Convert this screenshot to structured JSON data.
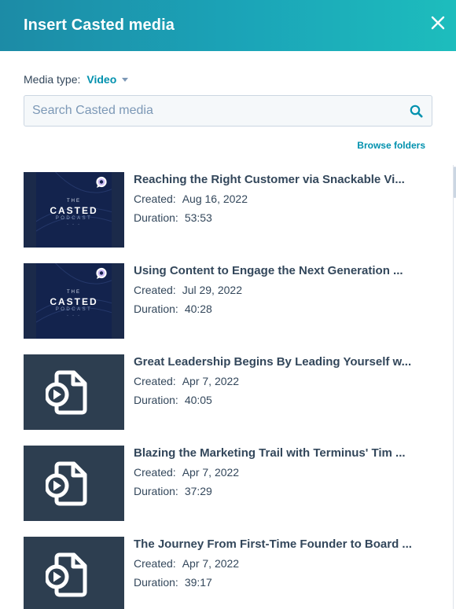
{
  "dialog": {
    "title": "Insert Casted media"
  },
  "media_type": {
    "label": "Media type:",
    "value": "Video"
  },
  "search": {
    "placeholder": "Search Casted media",
    "value": ""
  },
  "browse_folders": "Browse folders",
  "labels": {
    "created": "Created:",
    "duration": "Duration:"
  },
  "podcast_thumb": {
    "line1": "THE",
    "line2": "CASTED",
    "line3": "PODCAST",
    "line4": "◦ ◦ ◦"
  },
  "colors": {
    "accent": "#0091ae",
    "header_start": "#1c8ba6",
    "header_end": "#1dbdbd",
    "thumb_bg": "#2d3e50"
  },
  "items": [
    {
      "title": "Reaching the Right Customer via Snackable Vi...",
      "created": "Aug 16, 2022",
      "duration": "53:53",
      "thumb": "podcast-art"
    },
    {
      "title": "Using Content to Engage the Next Generation ...",
      "created": "Jul 29, 2022",
      "duration": "40:28",
      "thumb": "podcast-art"
    },
    {
      "title": "Great Leadership Begins By Leading Yourself w...",
      "created": "Apr 7, 2022",
      "duration": "40:05",
      "thumb": "video-file-icon"
    },
    {
      "title": "Blazing the Marketing Trail with Terminus' Tim ...",
      "created": "Apr 7, 2022",
      "duration": "37:29",
      "thumb": "video-file-icon"
    },
    {
      "title": "The Journey From First-Time Founder to Board ...",
      "created": "Apr 7, 2022",
      "duration": "39:17",
      "thumb": "video-file-icon"
    }
  ]
}
